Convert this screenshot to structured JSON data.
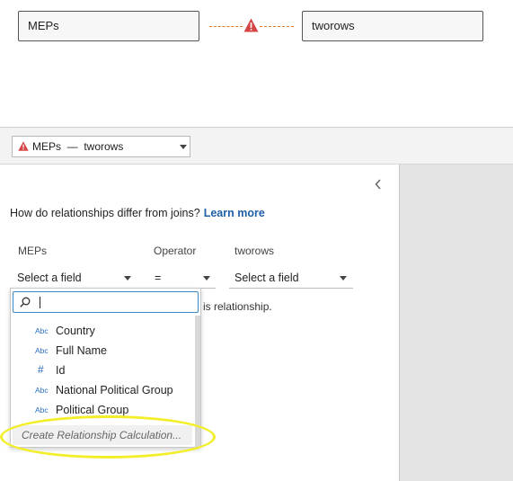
{
  "canvas": {
    "left_table": "MEPs",
    "right_table": "tworows"
  },
  "relationship_bar": {
    "selected_relationship": "MEPs  —  tworows"
  },
  "panel": {
    "question": "How do relationships differ from joins?",
    "learn_more": "Learn more",
    "columns": {
      "left_label": "MEPs",
      "operator_label": "Operator",
      "right_label": "tworows"
    },
    "left_field_placeholder": "Select a field",
    "operator_value": "=",
    "right_field_placeholder": "Select a field",
    "hint_text": "is relationship."
  },
  "dropdown": {
    "search_value": "",
    "items": [
      {
        "type": "Abc",
        "label": "Country"
      },
      {
        "type": "Abc",
        "label": "Full Name"
      },
      {
        "type": "#",
        "label": "Id"
      },
      {
        "type": "Abc",
        "label": "National Political Group"
      },
      {
        "type": "Abc",
        "label": "Political Group"
      }
    ],
    "create_calc": "Create Relationship Calculation..."
  },
  "colors": {
    "warning": "#d64545",
    "link": "#1f5fa8",
    "dashed_line": "#e07a28",
    "highlight": "#f3ee2a"
  }
}
